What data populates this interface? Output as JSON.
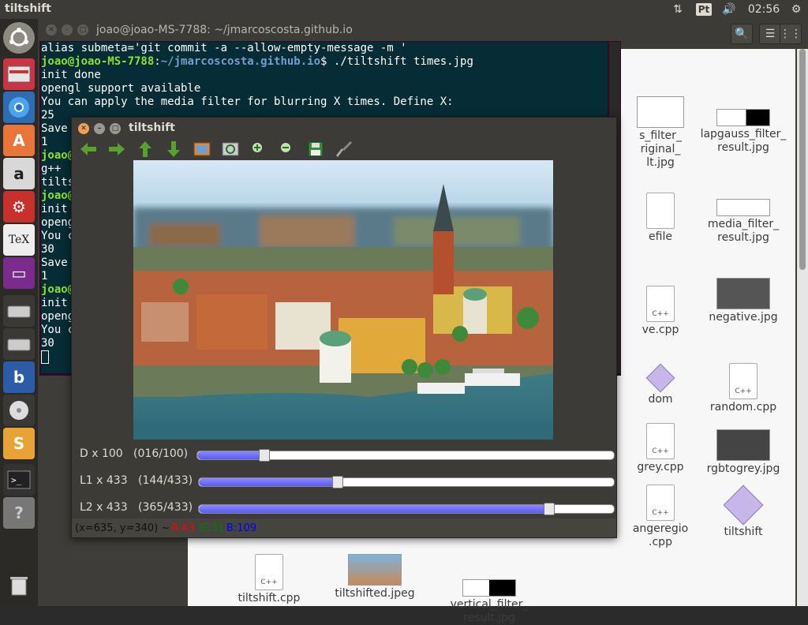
{
  "topbar": {
    "app_title": "tiltshift",
    "keyboard_layout": "Pt",
    "clock": "02:56"
  },
  "launcher": {
    "items": [
      "Dash",
      "Files",
      "Chromium",
      "Ubuntu Software Center",
      "Amazon",
      "System Settings",
      "TeXworks",
      "Workspaces",
      "Drive",
      "Drive",
      "Browser",
      "Disk",
      "Sublime Text",
      "Terminal",
      "Help",
      "Trash"
    ]
  },
  "files": {
    "labels": {
      "f1": "s_filter_",
      "f1b": "riginal_",
      "f1c": "lt.jpg",
      "f2": "lapgauss_filter_",
      "f2b": "result.jpg",
      "f3": "efile",
      "f4": "media_filter_",
      "f4b": "result.jpg",
      "f5": "ve.cpp",
      "f6": "negative.jpg",
      "f7": "dom",
      "f8": "random.cpp",
      "f9": "grey.cpp",
      "f10": "rgbtogrey.jpg",
      "f11": "angeregio",
      "f11b": ".cpp",
      "f12": "tiltshift",
      "f13": "tiltshift.cpp",
      "f14": "tiltshifted.jpeg",
      "f15": "vertical_filter_",
      "f15b": "result.jpg"
    }
  },
  "terminal": {
    "title": "joao@joao-MS-7788: ~/jmarcoscosta.github.io",
    "lines": {
      "l1": "alias submeta='git commit -a --allow-empty-message -m '",
      "prompt_user": "joao@joao-MS-7788",
      "prompt_sep": ":",
      "prompt_path": "~/jmarcoscosta.github.io",
      "prompt_cmd": "$ ./tiltshift times.jpg",
      "l3": "init done",
      "l4": "opengl support available",
      "l5": "You can apply the media filter for blurring X times. Define X:",
      "l6": "25",
      "l7": "Save",
      "l8": "1",
      "l9": "joao@",
      "l10": "g++ ",
      "l11": "tilts",
      "l12": "joao@",
      "l13": "init",
      "l14": "openg",
      "l15": "You c",
      "l16": "30",
      "l17": "Save",
      "l18": "1",
      "l19": "joao@",
      "l20": "init",
      "l21": "openg",
      "l22": "You c",
      "l23": "30"
    }
  },
  "tiltshift": {
    "title": "tiltshift",
    "sliders": [
      {
        "label": "D x 100",
        "value_text": "(016/100)",
        "fraction": 0.16
      },
      {
        "label": "L1 x 433",
        "value_text": "(144/433)",
        "fraction": 0.3326
      },
      {
        "label": "L2 x 433",
        "value_text": "(365/433)",
        "fraction": 0.843
      }
    ],
    "status": {
      "coords": "(x=635, y=340) ~",
      "r": "R:43",
      "g": "G:31",
      "b": "B:109"
    },
    "colors": {
      "r": "#ff0000",
      "g": "#008000",
      "b": "#0000ff"
    }
  }
}
